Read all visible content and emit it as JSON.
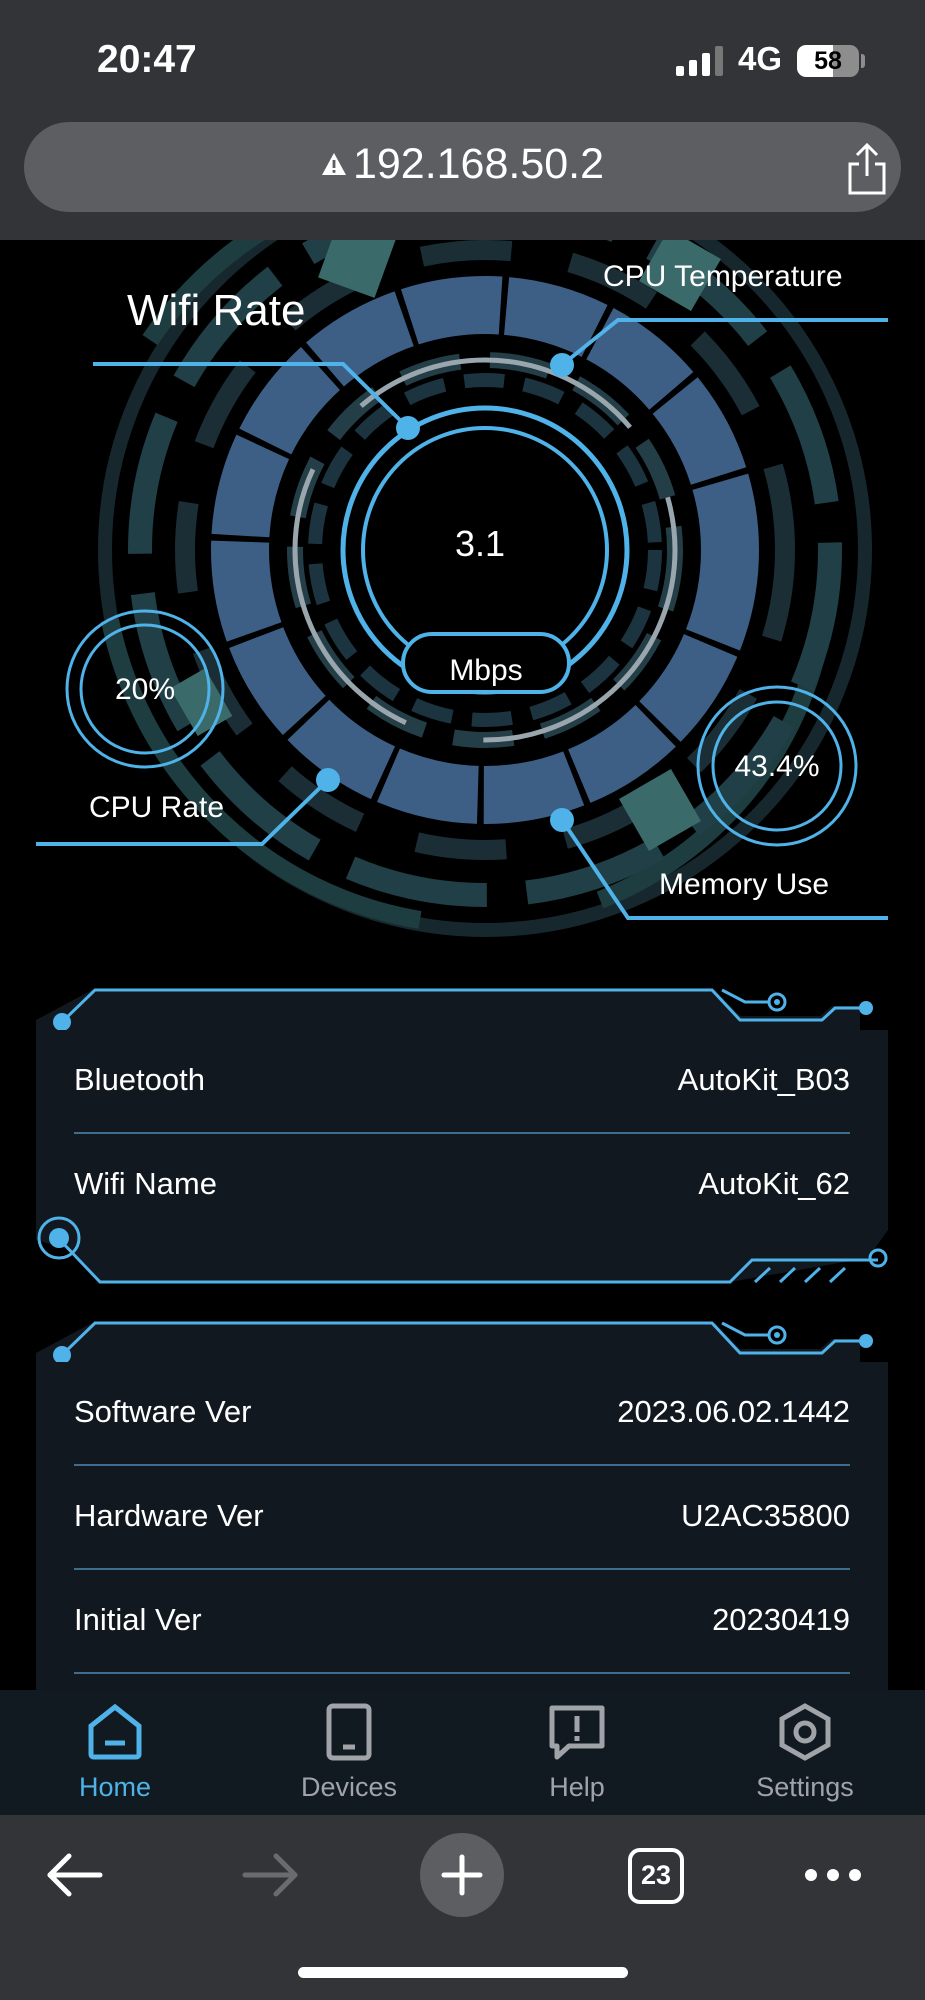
{
  "status_bar": {
    "time": "20:47",
    "network": "4G",
    "battery": "58",
    "battery_level": 0.58
  },
  "browser": {
    "url": "192.168.50.2",
    "tab_count": "23"
  },
  "dashboard": {
    "wifi_rate_label": "Wifi Rate",
    "wifi_rate_value": "3.1",
    "wifi_rate_unit": "Mbps",
    "cpu_temperature_label": "CPU Temperature",
    "cpu_rate_label": "CPU Rate",
    "cpu_rate_value": "20%",
    "memory_use_label": "Memory Use",
    "memory_use_value": "43.4%"
  },
  "device_info": [
    {
      "key": "Bluetooth",
      "value": "AutoKit_B03"
    },
    {
      "key": "Wifi Name",
      "value": "AutoKit_62"
    }
  ],
  "version_info": [
    {
      "key": "Software Ver",
      "value": "2023.06.02.1442"
    },
    {
      "key": "Hardware Ver",
      "value": "U2AC35800"
    },
    {
      "key": "Initial Ver",
      "value": "20230419"
    }
  ],
  "tabs": [
    {
      "label": "Home",
      "icon": "home-icon",
      "active": true
    },
    {
      "label": "Devices",
      "icon": "tablet-icon",
      "active": false
    },
    {
      "label": "Help",
      "icon": "help-message-icon",
      "active": false
    },
    {
      "label": "Settings",
      "icon": "settings-hexagon-icon",
      "active": false
    }
  ],
  "colors": {
    "accent": "#4fb2e8",
    "panel": "#111820",
    "ring": "#3d5f86"
  }
}
